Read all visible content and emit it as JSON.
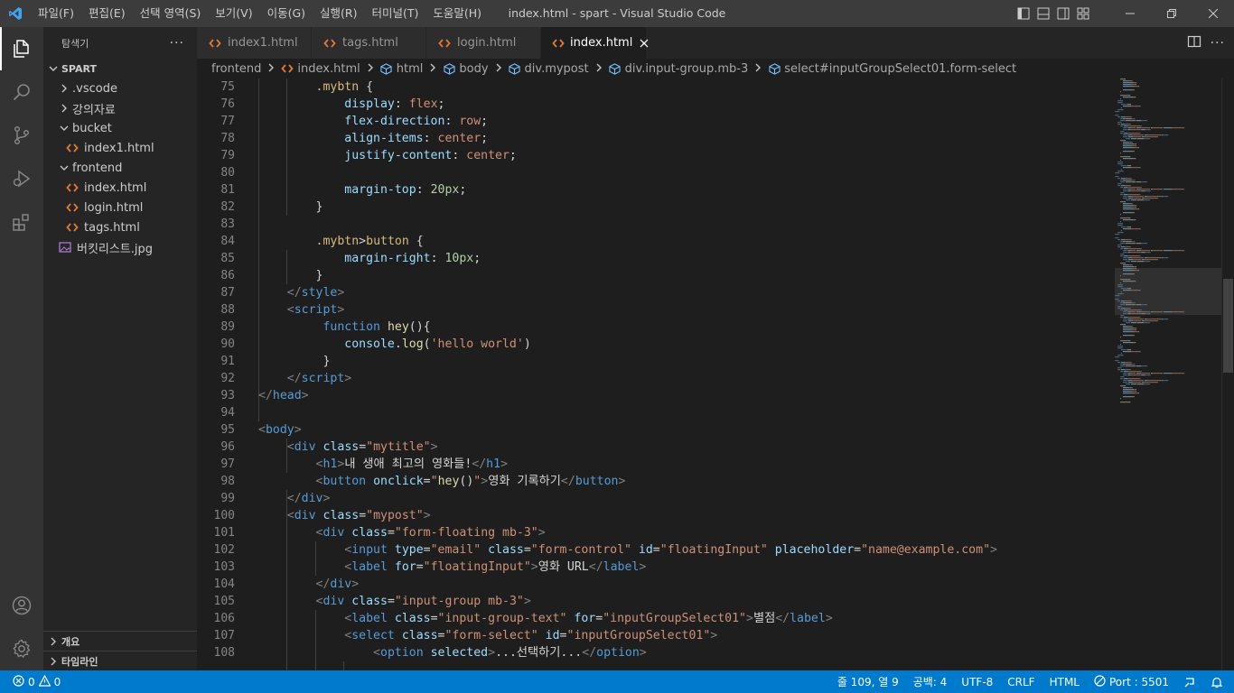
{
  "window_title": "index.html - spart - Visual Studio Code",
  "menu": [
    "파일(F)",
    "편집(E)",
    "선택 영역(S)",
    "보기(V)",
    "이동(G)",
    "실행(R)",
    "터미널(T)",
    "도움말(H)"
  ],
  "explorer": {
    "title": "탐색기",
    "folder": "SPART",
    "items": [
      {
        "label": ".vscode",
        "type": "folder",
        "depth": 1,
        "expanded": false
      },
      {
        "label": "강의자료",
        "type": "folder",
        "depth": 1,
        "expanded": false
      },
      {
        "label": "bucket",
        "type": "folder",
        "depth": 1,
        "expanded": true
      },
      {
        "label": "index1.html",
        "type": "html",
        "depth": 2
      },
      {
        "label": "frontend",
        "type": "folder",
        "depth": 1,
        "expanded": true
      },
      {
        "label": "index.html",
        "type": "html",
        "depth": 2
      },
      {
        "label": "login.html",
        "type": "html",
        "depth": 2
      },
      {
        "label": "tags.html",
        "type": "html",
        "depth": 2
      },
      {
        "label": "버킷리스트.jpg",
        "type": "image",
        "depth": 1
      }
    ],
    "outline_label": "개요",
    "timeline_label": "타임라인"
  },
  "tabs": [
    {
      "label": "index1.html",
      "active": false
    },
    {
      "label": "tags.html",
      "active": false
    },
    {
      "label": "login.html",
      "active": false
    },
    {
      "label": "index.html",
      "active": true
    }
  ],
  "breadcrumb": [
    {
      "label": "frontend",
      "icon": "none"
    },
    {
      "label": "index.html",
      "icon": "html"
    },
    {
      "label": "html",
      "icon": "cube"
    },
    {
      "label": "body",
      "icon": "cube"
    },
    {
      "label": "div.mypost",
      "icon": "cube"
    },
    {
      "label": "div.input-group.mb-3",
      "icon": "cube"
    },
    {
      "label": "select#inputGroupSelect01.form-select",
      "icon": "cube"
    }
  ],
  "editor": {
    "lines": [
      {
        "n": 75,
        "tokens": [
          [
            "        ",
            "txt"
          ],
          [
            ".mybtn",
            "sel"
          ],
          [
            " {",
            "punc"
          ]
        ]
      },
      {
        "n": 76,
        "tokens": [
          [
            "            ",
            "txt"
          ],
          [
            "display",
            "prop"
          ],
          [
            ": ",
            "punc"
          ],
          [
            "flex",
            "val"
          ],
          [
            ";",
            "punc"
          ]
        ]
      },
      {
        "n": 77,
        "tokens": [
          [
            "            ",
            "txt"
          ],
          [
            "flex-direction",
            "prop"
          ],
          [
            ": ",
            "punc"
          ],
          [
            "row",
            "val"
          ],
          [
            ";",
            "punc"
          ]
        ]
      },
      {
        "n": 78,
        "tokens": [
          [
            "            ",
            "txt"
          ],
          [
            "align-items",
            "prop"
          ],
          [
            ": ",
            "punc"
          ],
          [
            "center",
            "val"
          ],
          [
            ";",
            "punc"
          ]
        ]
      },
      {
        "n": 79,
        "tokens": [
          [
            "            ",
            "txt"
          ],
          [
            "justify-content",
            "prop"
          ],
          [
            ": ",
            "punc"
          ],
          [
            "center",
            "val"
          ],
          [
            ";",
            "punc"
          ]
        ]
      },
      {
        "n": 80,
        "tokens": []
      },
      {
        "n": 81,
        "tokens": [
          [
            "            ",
            "txt"
          ],
          [
            "margin-top",
            "prop"
          ],
          [
            ": ",
            "punc"
          ],
          [
            "20px",
            "num"
          ],
          [
            ";",
            "punc"
          ]
        ]
      },
      {
        "n": 82,
        "tokens": [
          [
            "        ",
            "txt"
          ],
          [
            "}",
            "punc"
          ]
        ]
      },
      {
        "n": 83,
        "tokens": []
      },
      {
        "n": 84,
        "tokens": [
          [
            "        ",
            "txt"
          ],
          [
            ".mybtn",
            "sel"
          ],
          [
            ">",
            "punc"
          ],
          [
            "button",
            "sel"
          ],
          [
            " {",
            "punc"
          ]
        ]
      },
      {
        "n": 85,
        "tokens": [
          [
            "            ",
            "txt"
          ],
          [
            "margin-right",
            "prop"
          ],
          [
            ": ",
            "punc"
          ],
          [
            "10px",
            "num"
          ],
          [
            ";",
            "punc"
          ]
        ]
      },
      {
        "n": 86,
        "tokens": [
          [
            "        ",
            "txt"
          ],
          [
            "}",
            "punc"
          ]
        ]
      },
      {
        "n": 87,
        "tokens": [
          [
            "    ",
            "txt"
          ],
          [
            "</",
            "br"
          ],
          [
            "style",
            "tag"
          ],
          [
            ">",
            "br"
          ]
        ]
      },
      {
        "n": 88,
        "tokens": [
          [
            "    ",
            "txt"
          ],
          [
            "<",
            "br"
          ],
          [
            "script",
            "tag"
          ],
          [
            ">",
            "br"
          ]
        ]
      },
      {
        "n": 89,
        "tokens": [
          [
            "         ",
            "txt"
          ],
          [
            "function",
            "kw"
          ],
          [
            " ",
            "txt"
          ],
          [
            "hey",
            "fn"
          ],
          [
            "(){",
            "punc"
          ]
        ]
      },
      {
        "n": 90,
        "tokens": [
          [
            "            ",
            "txt"
          ],
          [
            "console",
            "prop"
          ],
          [
            ".",
            "punc"
          ],
          [
            "log",
            "fn"
          ],
          [
            "(",
            "punc"
          ],
          [
            "'hello world'",
            "str"
          ],
          [
            ")",
            "punc"
          ]
        ]
      },
      {
        "n": 91,
        "tokens": [
          [
            "         ",
            "txt"
          ],
          [
            "}",
            "punc"
          ]
        ]
      },
      {
        "n": 92,
        "tokens": [
          [
            "    ",
            "txt"
          ],
          [
            "</",
            "br"
          ],
          [
            "script",
            "tag"
          ],
          [
            ">",
            "br"
          ]
        ]
      },
      {
        "n": 93,
        "tokens": [
          [
            "</",
            "br"
          ],
          [
            "head",
            "tag"
          ],
          [
            ">",
            "br"
          ]
        ]
      },
      {
        "n": 94,
        "tokens": []
      },
      {
        "n": 95,
        "tokens": [
          [
            "<",
            "br"
          ],
          [
            "body",
            "tag"
          ],
          [
            ">",
            "br"
          ]
        ]
      },
      {
        "n": 96,
        "tokens": [
          [
            "    ",
            "txt"
          ],
          [
            "<",
            "br"
          ],
          [
            "div",
            "tag"
          ],
          [
            " ",
            "txt"
          ],
          [
            "class",
            "attr"
          ],
          [
            "=",
            "punc"
          ],
          [
            "\"mytitle\"",
            "str"
          ],
          [
            ">",
            "br"
          ]
        ]
      },
      {
        "n": 97,
        "tokens": [
          [
            "        ",
            "txt"
          ],
          [
            "<",
            "br"
          ],
          [
            "h1",
            "tag"
          ],
          [
            ">",
            "br"
          ],
          [
            "내 생애 최고의 영화들!",
            "txt"
          ],
          [
            "</",
            "br"
          ],
          [
            "h1",
            "tag"
          ],
          [
            ">",
            "br"
          ]
        ]
      },
      {
        "n": 98,
        "tokens": [
          [
            "        ",
            "txt"
          ],
          [
            "<",
            "br"
          ],
          [
            "button",
            "tag"
          ],
          [
            " ",
            "txt"
          ],
          [
            "onclick",
            "attr"
          ],
          [
            "=",
            "punc"
          ],
          [
            "\"",
            "str"
          ],
          [
            "hey",
            "fn"
          ],
          [
            "()",
            "punc"
          ],
          [
            "\"",
            "str"
          ],
          [
            ">",
            "br"
          ],
          [
            "영화 기록하기",
            "txt"
          ],
          [
            "</",
            "br"
          ],
          [
            "button",
            "tag"
          ],
          [
            ">",
            "br"
          ]
        ]
      },
      {
        "n": 99,
        "tokens": [
          [
            "    ",
            "txt"
          ],
          [
            "</",
            "br"
          ],
          [
            "div",
            "tag"
          ],
          [
            ">",
            "br"
          ]
        ]
      },
      {
        "n": 100,
        "tokens": [
          [
            "    ",
            "txt"
          ],
          [
            "<",
            "br"
          ],
          [
            "div",
            "tag"
          ],
          [
            " ",
            "txt"
          ],
          [
            "class",
            "attr"
          ],
          [
            "=",
            "punc"
          ],
          [
            "\"mypost\"",
            "str"
          ],
          [
            ">",
            "br"
          ]
        ]
      },
      {
        "n": 101,
        "tokens": [
          [
            "        ",
            "txt"
          ],
          [
            "<",
            "br"
          ],
          [
            "div",
            "tag"
          ],
          [
            " ",
            "txt"
          ],
          [
            "class",
            "attr"
          ],
          [
            "=",
            "punc"
          ],
          [
            "\"form-floating mb-3\"",
            "str"
          ],
          [
            ">",
            "br"
          ]
        ]
      },
      {
        "n": 102,
        "tokens": [
          [
            "            ",
            "txt"
          ],
          [
            "<",
            "br"
          ],
          [
            "input",
            "tag"
          ],
          [
            " ",
            "txt"
          ],
          [
            "type",
            "attr"
          ],
          [
            "=",
            "punc"
          ],
          [
            "\"email\"",
            "str"
          ],
          [
            " ",
            "txt"
          ],
          [
            "class",
            "attr"
          ],
          [
            "=",
            "punc"
          ],
          [
            "\"form-control\"",
            "str"
          ],
          [
            " ",
            "txt"
          ],
          [
            "id",
            "attr"
          ],
          [
            "=",
            "punc"
          ],
          [
            "\"floatingInput\"",
            "str"
          ],
          [
            " ",
            "txt"
          ],
          [
            "placeholder",
            "attr"
          ],
          [
            "=",
            "punc"
          ],
          [
            "\"name@example.com\"",
            "str"
          ],
          [
            ">",
            "br"
          ]
        ]
      },
      {
        "n": 103,
        "tokens": [
          [
            "            ",
            "txt"
          ],
          [
            "<",
            "br"
          ],
          [
            "label",
            "tag"
          ],
          [
            " ",
            "txt"
          ],
          [
            "for",
            "attr"
          ],
          [
            "=",
            "punc"
          ],
          [
            "\"floatingInput\"",
            "str"
          ],
          [
            ">",
            "br"
          ],
          [
            "영화 URL",
            "txt"
          ],
          [
            "</",
            "br"
          ],
          [
            "label",
            "tag"
          ],
          [
            ">",
            "br"
          ]
        ]
      },
      {
        "n": 104,
        "tokens": [
          [
            "        ",
            "txt"
          ],
          [
            "</",
            "br"
          ],
          [
            "div",
            "tag"
          ],
          [
            ">",
            "br"
          ]
        ]
      },
      {
        "n": 105,
        "tokens": [
          [
            "        ",
            "txt"
          ],
          [
            "<",
            "br"
          ],
          [
            "div",
            "tag"
          ],
          [
            " ",
            "txt"
          ],
          [
            "class",
            "attr"
          ],
          [
            "=",
            "punc"
          ],
          [
            "\"input-group mb-3\"",
            "str"
          ],
          [
            ">",
            "br"
          ]
        ]
      },
      {
        "n": 106,
        "tokens": [
          [
            "            ",
            "txt"
          ],
          [
            "<",
            "br"
          ],
          [
            "label",
            "tag"
          ],
          [
            " ",
            "txt"
          ],
          [
            "class",
            "attr"
          ],
          [
            "=",
            "punc"
          ],
          [
            "\"input-group-text\"",
            "str"
          ],
          [
            " ",
            "txt"
          ],
          [
            "for",
            "attr"
          ],
          [
            "=",
            "punc"
          ],
          [
            "\"inputGroupSelect01\"",
            "str"
          ],
          [
            ">",
            "br"
          ],
          [
            "별점",
            "txt"
          ],
          [
            "</",
            "br"
          ],
          [
            "label",
            "tag"
          ],
          [
            ">",
            "br"
          ]
        ]
      },
      {
        "n": 107,
        "tokens": [
          [
            "            ",
            "txt"
          ],
          [
            "<",
            "br"
          ],
          [
            "select",
            "tag"
          ],
          [
            " ",
            "txt"
          ],
          [
            "class",
            "attr"
          ],
          [
            "=",
            "punc"
          ],
          [
            "\"form-select\"",
            "str"
          ],
          [
            " ",
            "txt"
          ],
          [
            "id",
            "attr"
          ],
          [
            "=",
            "punc"
          ],
          [
            "\"inputGroupSelect01\"",
            "str"
          ],
          [
            ">",
            "br"
          ]
        ]
      },
      {
        "n": 108,
        "tokens": [
          [
            "                ",
            "txt"
          ],
          [
            "<",
            "br"
          ],
          [
            "option",
            "tag"
          ],
          [
            " ",
            "txt"
          ],
          [
            "selected",
            "attr"
          ],
          [
            ">",
            "br"
          ],
          [
            "...선택하기...",
            "txt"
          ],
          [
            "</",
            "br"
          ],
          [
            "option",
            "tag"
          ],
          [
            ">",
            "br"
          ]
        ]
      }
    ]
  },
  "status": {
    "errors": "0",
    "warnings": "0",
    "position": "줄 109, 열 9",
    "spaces": "공백: 4",
    "encoding": "UTF-8",
    "eol": "CRLF",
    "language": "HTML",
    "port": "Port : 5501"
  },
  "colors": {
    "accent": "#007acc",
    "html_icon": "#e37933",
    "folder_icon_twisty": "#c5c5c5",
    "image_icon": "#a074c4"
  }
}
